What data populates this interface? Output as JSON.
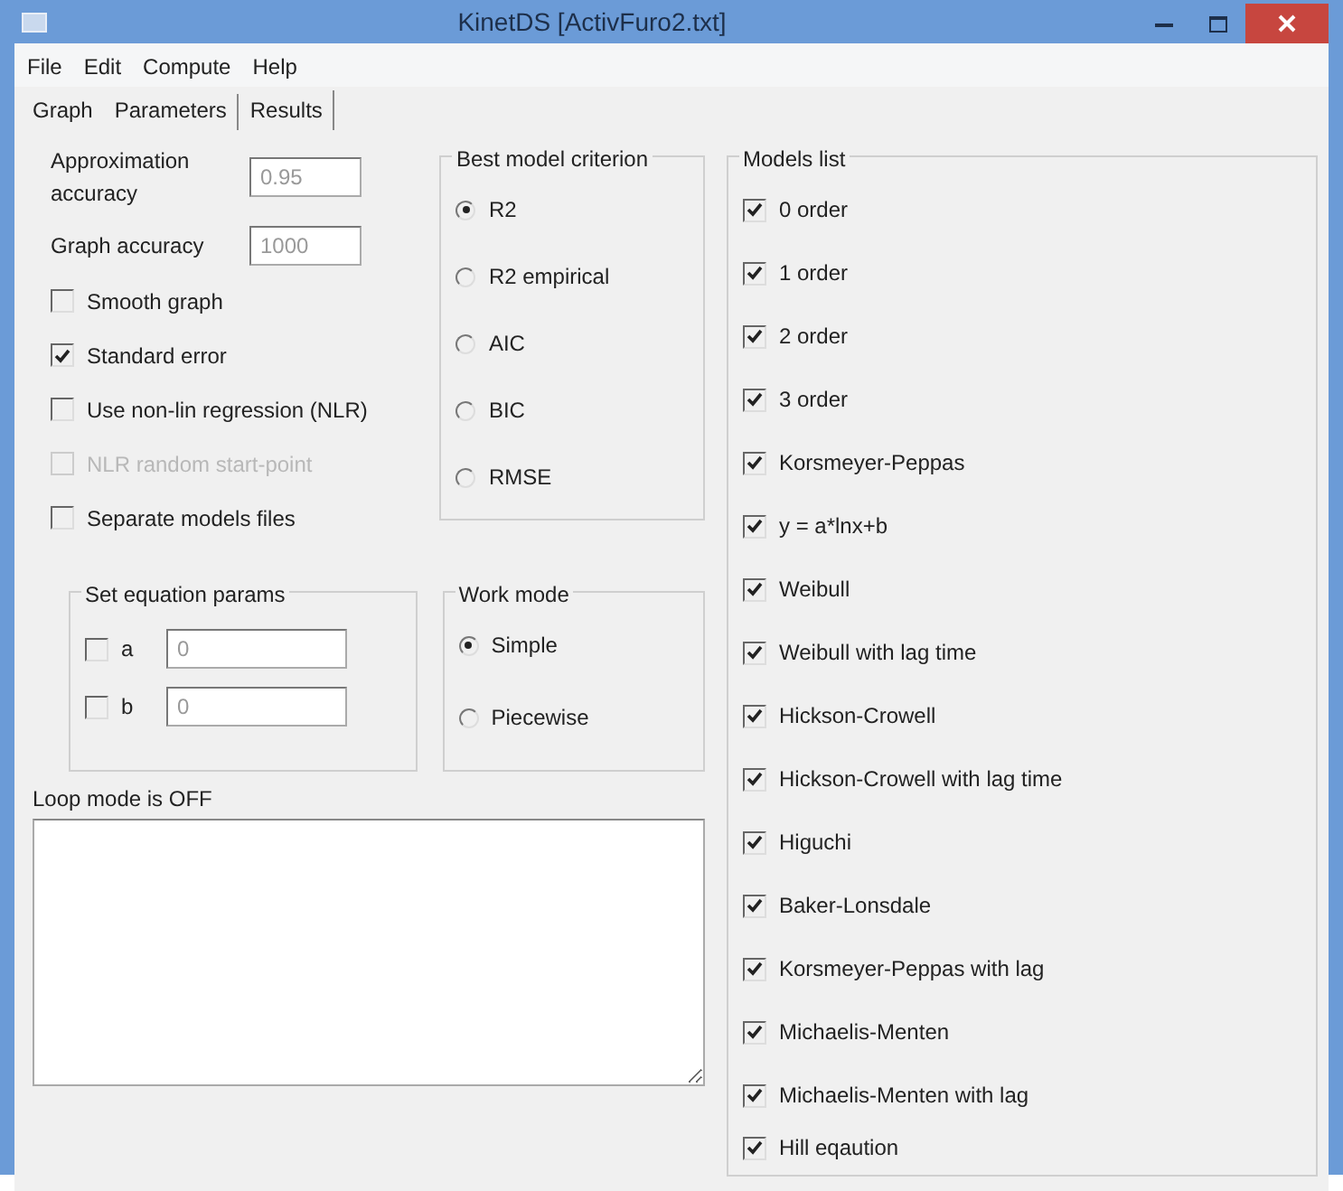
{
  "window": {
    "title": "KinetDS [ActivFuro2.txt]"
  },
  "menu": [
    "File",
    "Edit",
    "Compute",
    "Help"
  ],
  "tabs": [
    {
      "label": "Graph",
      "selected": false
    },
    {
      "label": "Parameters",
      "selected": true
    },
    {
      "label": "Results",
      "selected": false
    }
  ],
  "fields": [
    {
      "label": "Approximation accuracy",
      "value": "0.95"
    },
    {
      "label": "Graph accuracy",
      "value": "1000"
    }
  ],
  "options": [
    {
      "label": "Smooth graph",
      "checked": false,
      "disabled": false
    },
    {
      "label": "Standard error",
      "checked": true,
      "disabled": false
    },
    {
      "label": "Use non-lin regression (NLR)",
      "checked": false,
      "disabled": false
    },
    {
      "label": "NLR random start-point",
      "checked": false,
      "disabled": true
    },
    {
      "label": "Separate models files",
      "checked": false,
      "disabled": false
    }
  ],
  "criterion": {
    "title": "Best model criterion",
    "options": [
      {
        "label": "R2",
        "selected": true
      },
      {
        "label": "R2 empirical",
        "selected": false
      },
      {
        "label": "AIC",
        "selected": false
      },
      {
        "label": "BIC",
        "selected": false
      },
      {
        "label": "RMSE",
        "selected": false
      }
    ]
  },
  "equation_params": {
    "title": "Set equation params",
    "items": [
      {
        "label": "a",
        "checked": false,
        "value": "0"
      },
      {
        "label": "b",
        "checked": false,
        "value": "0"
      }
    ]
  },
  "work_mode": {
    "title": "Work mode",
    "options": [
      {
        "label": "Simple",
        "selected": true
      },
      {
        "label": "Piecewise",
        "selected": false
      }
    ]
  },
  "loop_label": "Loop mode is OFF",
  "models": {
    "title": "Models list",
    "items": [
      {
        "label": "0 order",
        "checked": true
      },
      {
        "label": "1 order",
        "checked": true
      },
      {
        "label": "2 order",
        "checked": true
      },
      {
        "label": "3 order",
        "checked": true
      },
      {
        "label": "Korsmeyer-Peppas",
        "checked": true
      },
      {
        "label": "y = a*lnx+b",
        "checked": true
      },
      {
        "label": "Weibull",
        "checked": true
      },
      {
        "label": "Weibull with lag time",
        "checked": true
      },
      {
        "label": "Hickson-Crowell",
        "checked": true
      },
      {
        "label": "Hickson-Crowell with lag time",
        "checked": true
      },
      {
        "label": "Higuchi",
        "checked": true
      },
      {
        "label": "Baker-Lonsdale",
        "checked": true
      },
      {
        "label": "Korsmeyer-Peppas with lag",
        "checked": true
      },
      {
        "label": "Michaelis-Menten",
        "checked": true
      },
      {
        "label": "Michaelis-Menten with lag",
        "checked": true
      },
      {
        "label": "Hill eqaution",
        "checked": true
      }
    ]
  }
}
